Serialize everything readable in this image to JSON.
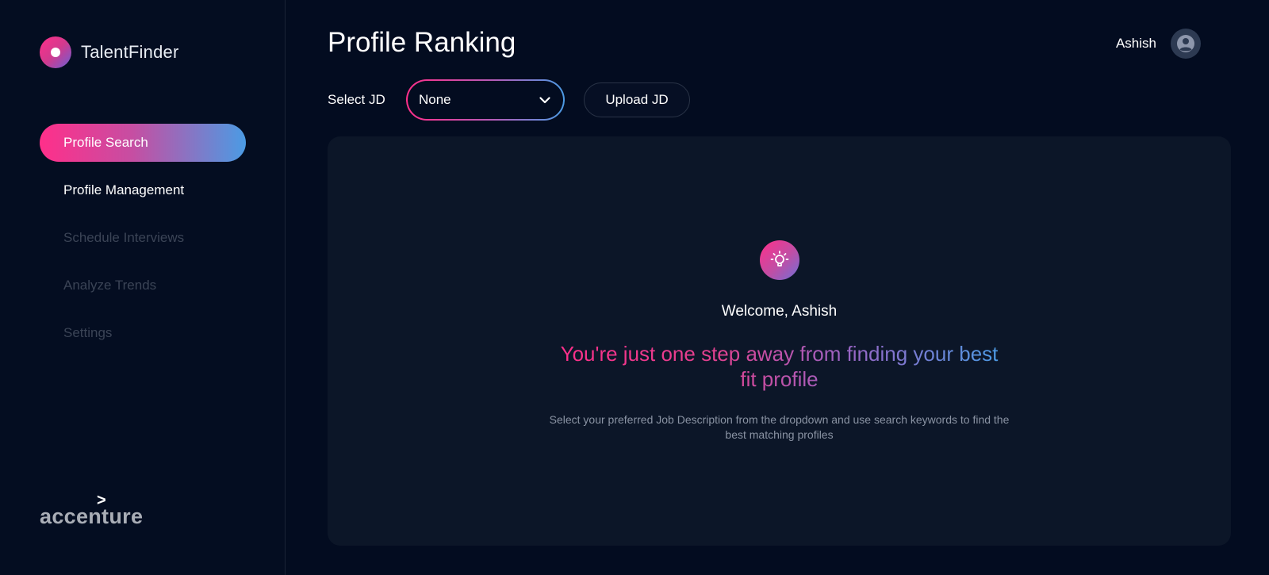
{
  "app": {
    "logo_text": "TalentFinder",
    "brand": "accenture"
  },
  "sidebar": {
    "items": [
      {
        "label": "Profile Search",
        "state": "active"
      },
      {
        "label": "Profile Management",
        "state": "enabled"
      },
      {
        "label": "Schedule Interviews",
        "state": "disabled"
      },
      {
        "label": "Analyze Trends",
        "state": "disabled"
      },
      {
        "label": "Settings",
        "state": "disabled"
      }
    ]
  },
  "header": {
    "title": "Profile Ranking",
    "user_name": "Ashish",
    "avatar_icon": "user-circle-icon"
  },
  "toolbar": {
    "select_label": "Select JD",
    "selected_jd": "None",
    "dropdown_icon": "chevron-down-icon",
    "upload_label": "Upload JD"
  },
  "empty_state": {
    "icon": "lightbulb-icon",
    "welcome": "Welcome, Ashish",
    "headline": "You're just one step away from finding your best fit profile",
    "description": "Select your preferred Job Description from the dropdown and use search keywords to find the best matching profiles"
  },
  "colors": {
    "background": "#030c20",
    "panel": "#0c1628",
    "accent_pink": "#ff2f8a",
    "accent_blue": "#4b9be4",
    "muted_text": "#8a93a3",
    "disabled_text": "#3b4456"
  }
}
